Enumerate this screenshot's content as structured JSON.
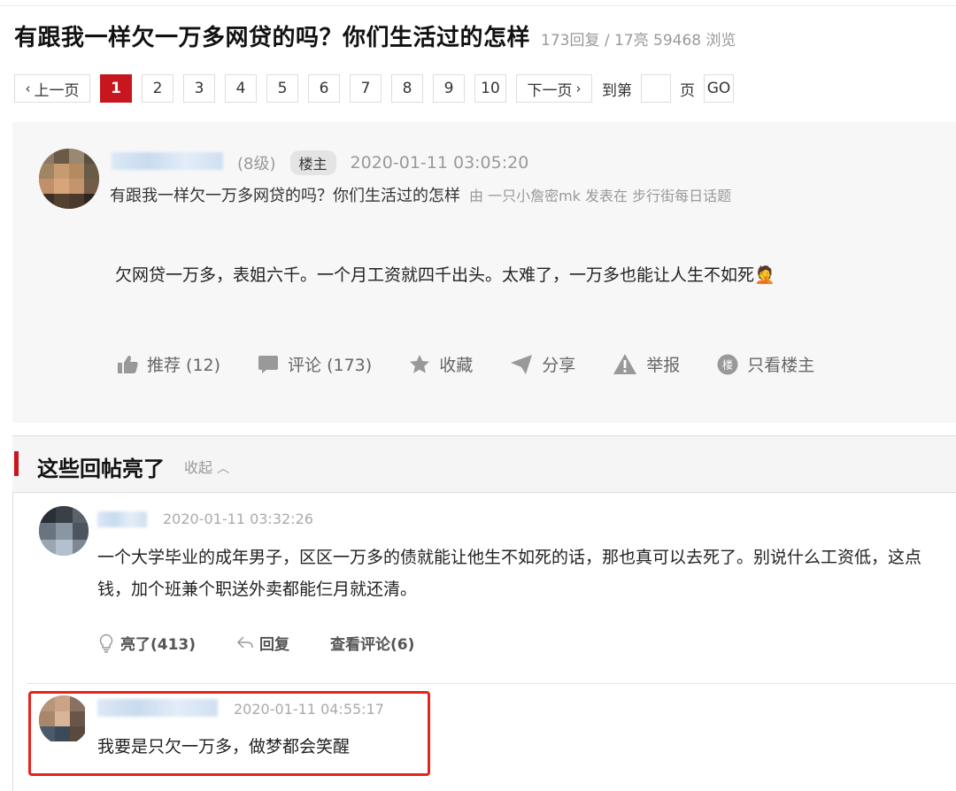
{
  "thread": {
    "title": "有跟我一样欠一万多网贷的吗？你们生活过的怎样",
    "stats": "173回复 / 17亮 59468 浏览"
  },
  "pagination": {
    "prev": "上一页",
    "pages": [
      "1",
      "2",
      "3",
      "4",
      "5",
      "6",
      "7",
      "8",
      "9",
      "10"
    ],
    "current": "1",
    "next": "下一页",
    "goto_prefix": "到第",
    "goto_suffix": "页",
    "go": "GO"
  },
  "post": {
    "level": "(8级)",
    "badge": "楼主",
    "date": "2020-01-11 03:05:20",
    "title": "有跟我一样欠一万多网贷的吗？你们生活过的怎样",
    "source": "由  一只小詹密mk 发表在  步行街每日话题",
    "body": "欠网贷一万多，表姐六千。一个月工资就四千出头。太难了，一万多也能让人生不如死🤦",
    "actions": {
      "recommend": "推荐 (12)",
      "comment": "评论 (173)",
      "favorite": "收藏",
      "share": "分享",
      "report": "举报",
      "only_op": "只看楼主"
    }
  },
  "highlights": {
    "title": "这些回帖亮了",
    "collapse": "收起",
    "replies": [
      {
        "date": "2020-01-11 03:32:26",
        "text": "一个大学毕业的成年男子，区区一万多的债就能让他生不如死的话，那也真可以去死了。别说什么工资低，这点钱，加个班兼个职送外卖都能仨月就还清。",
        "light": "亮了(413)",
        "reply": "回复",
        "view_comments": "查看评论(6)"
      },
      {
        "date": "2020-01-11 04:55:17",
        "text": "我要是只欠一万多，做梦都会笑醒"
      }
    ]
  },
  "colors": {
    "accent": "#c8161e",
    "highlight_box": "#e8231c"
  }
}
